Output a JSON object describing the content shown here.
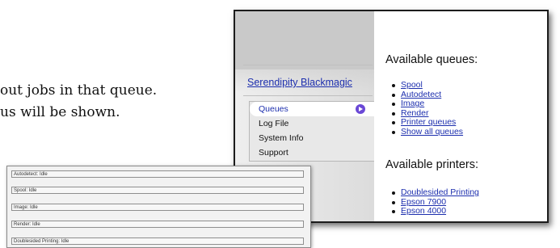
{
  "document": {
    "line1": "out jobs in that queue.",
    "line2": "us will be shown."
  },
  "sidebar": {
    "site_title": "Serendipity Blackmagic",
    "nav_items": [
      {
        "label": "Queues",
        "active": true
      },
      {
        "label": "Log File",
        "active": false
      },
      {
        "label": "System Info",
        "active": false
      },
      {
        "label": "Support",
        "active": false
      }
    ]
  },
  "content": {
    "queues_heading": "Available queues:",
    "queues": [
      "Spool",
      "Autodetect",
      "Image",
      "Render",
      "Printer queues",
      "Show all queues"
    ],
    "printers_heading": "Available printers:",
    "printers": [
      "Doublesided Printing",
      "Epson 7900",
      "Epson 4000"
    ]
  },
  "status_panel": {
    "rows": [
      "Autodetect: Idle",
      "Spool: Idle",
      "Image: Idle",
      "Render: Idle",
      "Doublesided Printing: Idle"
    ]
  },
  "colors": {
    "link": "#1d2fae",
    "active_arrow": "#6a48d6"
  },
  "icons": {
    "nav_arrow": "arrow-right-circle-icon"
  }
}
